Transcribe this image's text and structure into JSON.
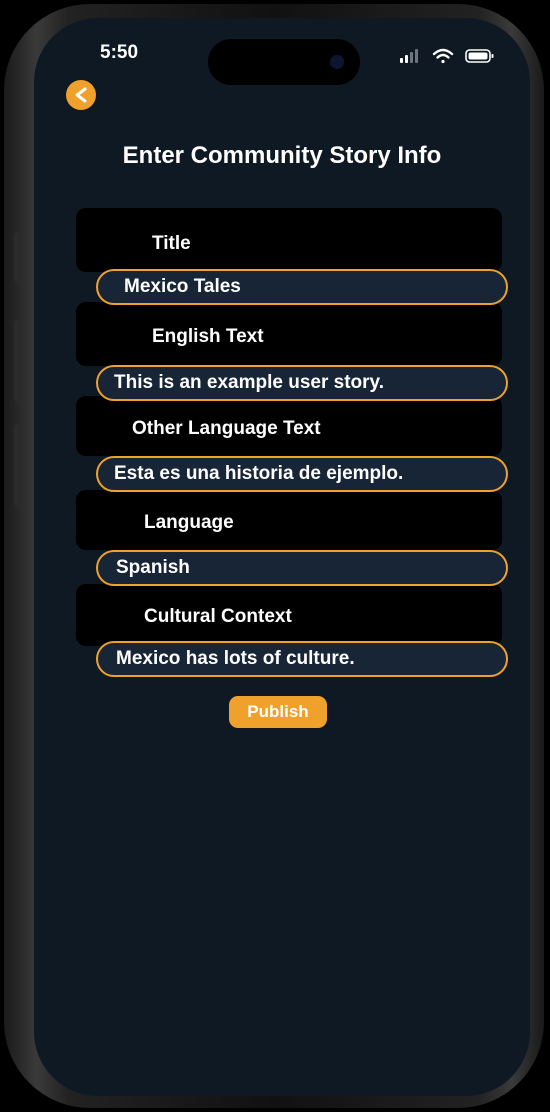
{
  "status_bar": {
    "time": "5:50",
    "signal_icon": "signal-bars-icon",
    "wifi_icon": "wifi-icon",
    "battery_icon": "battery-icon"
  },
  "header": {
    "back_icon": "chevron-left-icon",
    "title": "Enter Community Story Info"
  },
  "form": {
    "fields": [
      {
        "label": "Title",
        "value": "Mexico Tales"
      },
      {
        "label": "English Text",
        "value": "This is an example user story."
      },
      {
        "label": "Other Language Text",
        "value": "Esta es una historia de ejemplo."
      },
      {
        "label": "Language",
        "value": "Spanish"
      },
      {
        "label": "Cultural Context",
        "value": "Mexico has lots of culture."
      }
    ],
    "publish_label": "Publish"
  },
  "colors": {
    "accent": "#f0a12b",
    "background": "#0f1924",
    "input_bg": "#182537",
    "label_block": "#000000"
  }
}
